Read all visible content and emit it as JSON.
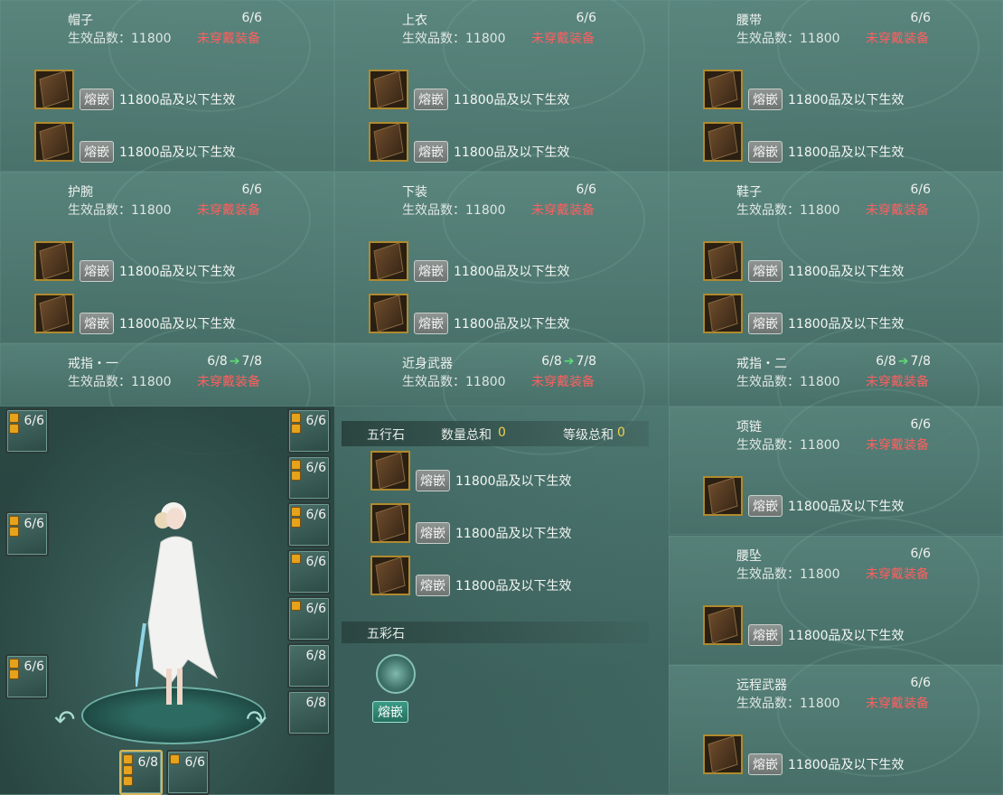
{
  "gem_slot": {
    "button": "熔嵌",
    "text": "11800品及以下生效"
  },
  "grade_text": "生效品数：11800",
  "status_text": "未穿戴装备",
  "panels": [
    {
      "name": "帽子",
      "count": "6/6"
    },
    {
      "name": "上衣",
      "count": "6/6"
    },
    {
      "name": "腰带",
      "count": "6/6"
    },
    {
      "name": "护腕",
      "count": "6/6"
    },
    {
      "name": "下装",
      "count": "6/6"
    },
    {
      "name": "鞋子",
      "count": "6/6"
    },
    {
      "name": "戒指・一",
      "count": "6/8",
      "next": "7/8"
    },
    {
      "name": "近身武器",
      "count": "6/8",
      "next": "7/8"
    },
    {
      "name": "戒指・二",
      "count": "6/8",
      "next": "7/8"
    },
    {
      "name": "项链",
      "count": "6/6"
    },
    {
      "name": "腰坠",
      "count": "6/6"
    },
    {
      "name": "远程武器",
      "count": "6/6"
    }
  ],
  "equip_slots_left": [
    "6/6",
    "6/6",
    "6/6"
  ],
  "equip_slots_right": [
    "6/6",
    "6/6",
    "6/6",
    "6/6",
    "6/6",
    "6/8",
    "6/8"
  ],
  "equip_slots_bottom": [
    "6/8",
    "6/6"
  ],
  "wuxing": {
    "title": "五行石",
    "qty_label": "数量总和",
    "qty_value": "0",
    "level_label": "等级总和",
    "level_value": "0"
  },
  "wucai": {
    "title": "五彩石",
    "button": "熔嵌"
  },
  "colors": {
    "status_red": "#ff5f5f",
    "arrow_green": "#5fdc74",
    "gem_border": "#b08a2e",
    "highlight_yellow": "#f0d24a"
  }
}
